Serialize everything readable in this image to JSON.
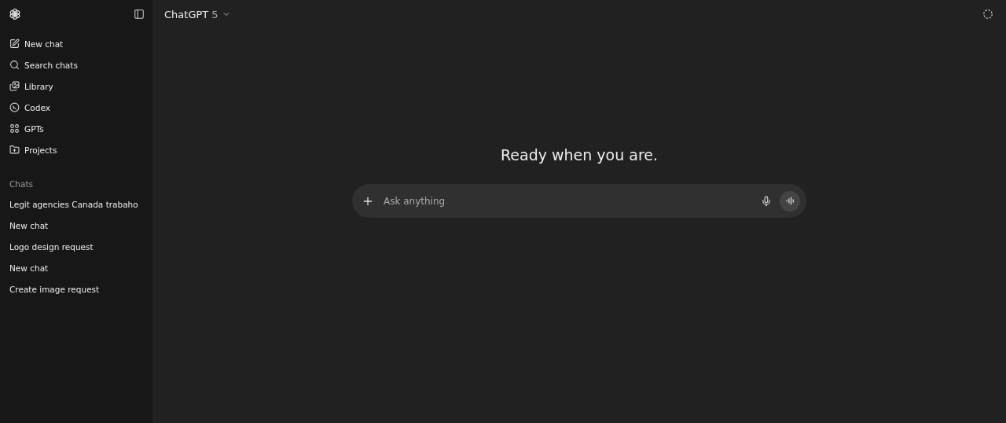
{
  "header": {
    "model": "ChatGPT",
    "version": "5"
  },
  "sidebar": {
    "items": [
      {
        "label": "New chat",
        "kind": "compose"
      },
      {
        "label": "Search chats",
        "kind": "search"
      },
      {
        "label": "Library",
        "kind": "library"
      },
      {
        "label": "Codex",
        "kind": "codex"
      },
      {
        "label": "GPTs",
        "kind": "gpts"
      },
      {
        "label": "Projects",
        "kind": "projects"
      }
    ],
    "chats_heading": "Chats",
    "chats": [
      "Legit agencies Canada trabaho",
      "New chat",
      "Logo design request",
      "New chat",
      "Create image request"
    ]
  },
  "main": {
    "greeting": "Ready when you are.",
    "composer": {
      "placeholder": "Ask anything"
    }
  }
}
